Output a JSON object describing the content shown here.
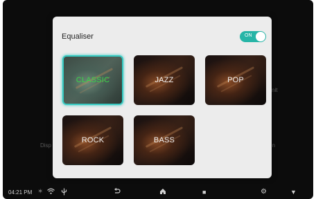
{
  "background": {
    "left_text": "Disp",
    "right_text": "on",
    "right_text_2": "nit"
  },
  "dialog": {
    "title": "Equaliser",
    "toggle": {
      "label": "ON",
      "state": true,
      "color": "#27b5a7"
    },
    "presets": [
      {
        "label": "CLASSIC",
        "selected": true
      },
      {
        "label": "JAZZ",
        "selected": false
      },
      {
        "label": "POP",
        "selected": false
      },
      {
        "label": "ROCK",
        "selected": false
      },
      {
        "label": "BASS",
        "selected": false
      }
    ],
    "accent_color": "#35c9c1",
    "selected_text_color": "#3ad64a"
  },
  "statusbar": {
    "time": "04:21 PM",
    "icons": {
      "bluetooth": "bluetooth-icon",
      "wifi": "wifi-icon",
      "usb": "usb-icon",
      "back": "back-icon",
      "home": "home-icon",
      "recent": "recent-apps-icon",
      "settings": "settings-icon",
      "dropdown": "dropdown-icon"
    }
  }
}
